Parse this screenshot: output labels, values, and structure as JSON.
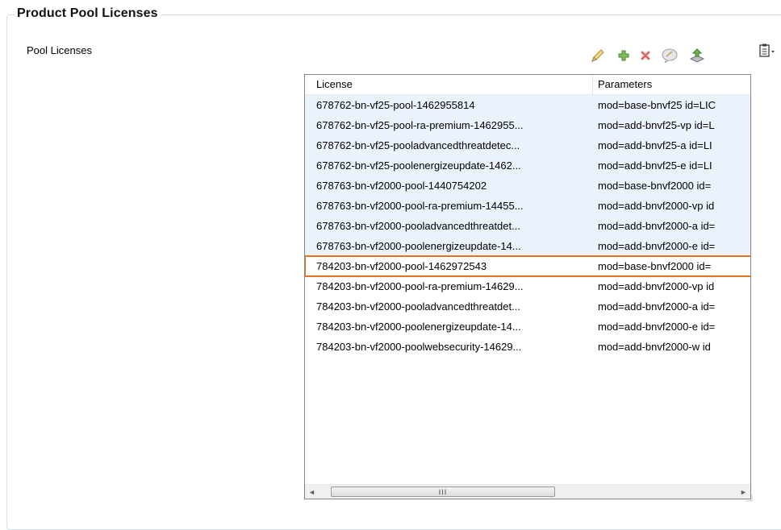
{
  "window": {
    "title": "Product Pool Licenses"
  },
  "section": {
    "label": "Pool Licenses"
  },
  "toolbar": {
    "buttons": [
      {
        "name": "edit-button",
        "icon": "pencil-icon"
      },
      {
        "name": "add-button",
        "icon": "plus-icon"
      },
      {
        "name": "delete-button",
        "icon": "x-icon"
      },
      {
        "name": "comment-button",
        "icon": "speech-bubble-icon"
      },
      {
        "name": "import-button",
        "icon": "import-icon"
      },
      {
        "name": "clipboard-menu-button",
        "icon": "clipboard-dropdown-icon"
      }
    ]
  },
  "table": {
    "columns": [
      "License",
      "Parameters"
    ],
    "selected_row": 8,
    "rows": [
      {
        "license": "678762-bn-vf25-pool-1462955814",
        "params": "mod=base-bnvf25 id=LIC"
      },
      {
        "license": "678762-bn-vf25-pool-ra-premium-1462955...",
        "params": "mod=add-bnvf25-vp id=L"
      },
      {
        "license": "678762-bn-vf25-pooladvancedthreatdetec...",
        "params": "mod=add-bnvf25-a id=LI"
      },
      {
        "license": "678762-bn-vf25-poolenergizeupdate-1462...",
        "params": "mod=add-bnvf25-e id=LI"
      },
      {
        "license": "678763-bn-vf2000-pool-1440754202",
        "params": "mod=base-bnvf2000 id="
      },
      {
        "license": "678763-bn-vf2000-pool-ra-premium-14455...",
        "params": "mod=add-bnvf2000-vp id"
      },
      {
        "license": "678763-bn-vf2000-pooladvancedthreatdet...",
        "params": "mod=add-bnvf2000-a id="
      },
      {
        "license": "678763-bn-vf2000-poolenergizeupdate-14...",
        "params": "mod=add-bnvf2000-e id="
      },
      {
        "license": "784203-bn-vf2000-pool-1462972543",
        "params": "mod=base-bnvf2000 id="
      },
      {
        "license": "784203-bn-vf2000-pool-ra-premium-14629...",
        "params": "mod=add-bnvf2000-vp id"
      },
      {
        "license": "784203-bn-vf2000-pooladvancedthreatdet...",
        "params": "mod=add-bnvf2000-a id="
      },
      {
        "license": "784203-bn-vf2000-poolenergizeupdate-14...",
        "params": "mod=add-bnvf2000-e id="
      },
      {
        "license": "784203-bn-vf2000-poolwebsecurity-14629...",
        "params": "mod=add-bnvf2000-w id"
      }
    ]
  },
  "scrollbar": {
    "thumb_label": "III",
    "left_arrow": "◄",
    "right_arrow": "►"
  },
  "colors": {
    "selection_border": "#e8731f",
    "row_highlight": "#eaf2fb"
  }
}
